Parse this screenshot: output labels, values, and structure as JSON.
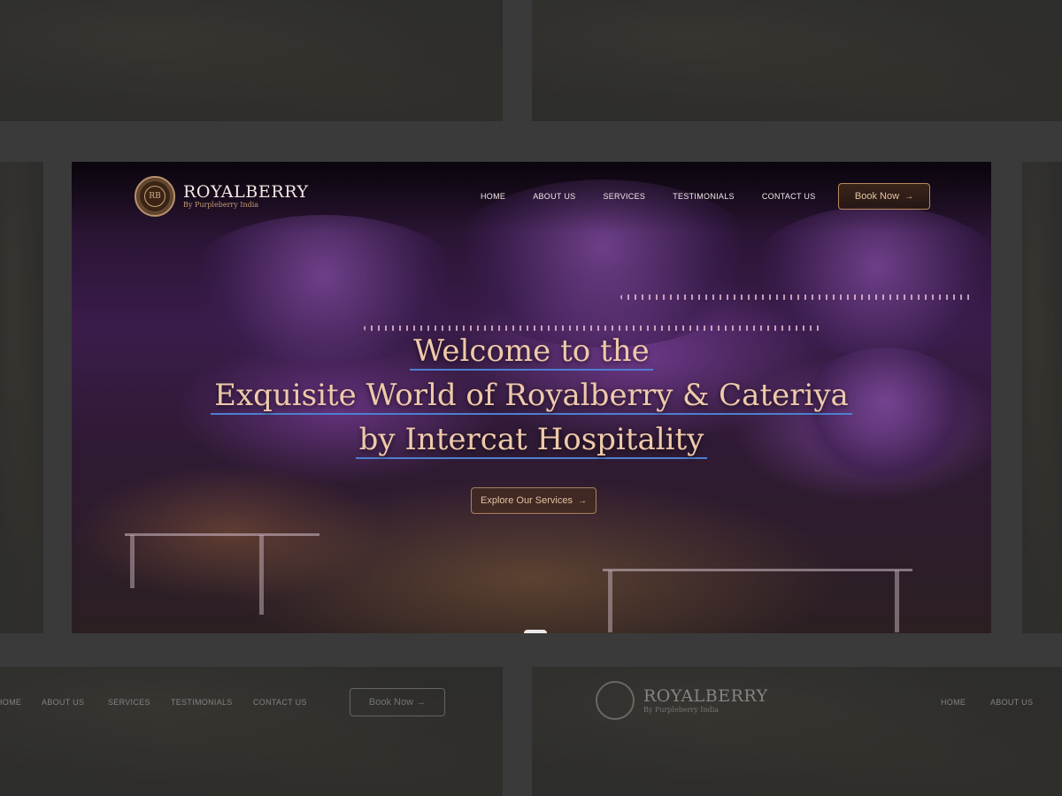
{
  "brand": {
    "title": "ROYALBERRY",
    "subtitle": "By Purpleberry India",
    "emblem": "RB"
  },
  "nav": {
    "items": [
      "HOME",
      "ABOUT US",
      "SERVICES",
      "TESTIMONIALS",
      "CONTACT US"
    ],
    "book_label": "Book Now",
    "arrow": "→"
  },
  "hero": {
    "line1": "Welcome to the",
    "line2": "Exquisite World of Royalberry & Cateriya",
    "line3": "by Intercat Hospitality",
    "cta_label": "Explore Our Services"
  },
  "ghost_bottom_left": {
    "nav": [
      "HOME",
      "ABOUT US",
      "SERVICES",
      "TESTIMONIALS",
      "CONTACT US"
    ],
    "book_label": "Book Now →"
  },
  "ghost_bottom_right": {
    "title": "ROYALBERRY",
    "subtitle": "By Purpleberry India",
    "nav": [
      "HOME",
      "ABOUT US"
    ]
  },
  "colors": {
    "accent_gold": "#b98a5e",
    "heading": "#efc9aa",
    "underline_blue": "#4d7fd1",
    "backdrop": "#3a3a3a"
  }
}
